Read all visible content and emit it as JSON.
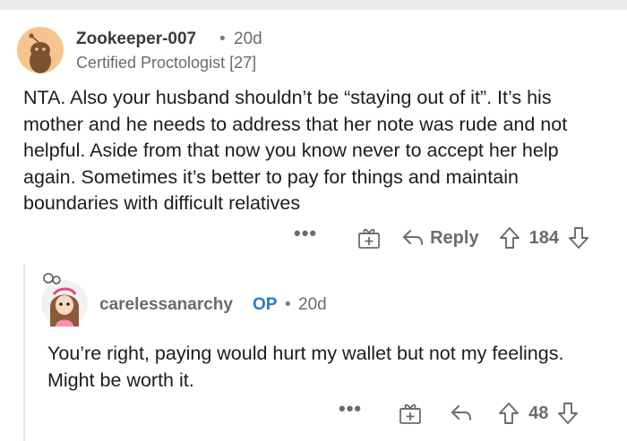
{
  "comment": {
    "username": "Zookeeper-007",
    "separator": "•",
    "age": "20d",
    "flair": "Certified Proctologist [27]",
    "body": "NTA. Also your husband shouldn’t be “staying out of it”. It’s his mother and he needs to address that her note was rude and not helpful. Aside from that now you know never to accept her help again. Sometimes it’s better to pay for things and maintain boundaries with difficult relatives",
    "actions": {
      "more": "•••",
      "reply_label": "Reply",
      "score": "184"
    }
  },
  "reply": {
    "username": "carelessanarchy",
    "op_badge": "OP",
    "separator": "•",
    "age": "20d",
    "body": "You’re right, paying would hurt my wallet but not my feelings. Might be worth it.",
    "actions": {
      "more": "•••",
      "score": "48"
    }
  },
  "icons": [
    "avatar",
    "award-icon",
    "reply-arrow-icon",
    "upvote-icon",
    "downvote-icon",
    "more-options-icon"
  ],
  "colors": {
    "op_badge": "#2a78d1",
    "meta": "#6b6b6b",
    "text": "#1c1c1c",
    "avatar1_bg": "#f6c58f"
  }
}
